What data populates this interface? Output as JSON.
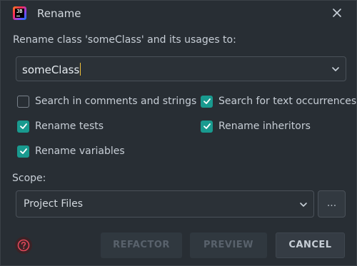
{
  "window": {
    "title": "Rename",
    "app_icon_text": "JB"
  },
  "prompt": "Rename class 'someClass' and its usages to:",
  "new_name": {
    "value": "someClass"
  },
  "options": [
    {
      "label": "Search in comments and strings",
      "checked": false
    },
    {
      "label": "Search for text occurrences",
      "checked": true
    },
    {
      "label": "Rename tests",
      "checked": true
    },
    {
      "label": "Rename inheritors",
      "checked": true
    },
    {
      "label": "Rename variables",
      "checked": true
    }
  ],
  "scope": {
    "label": "Scope:",
    "selected": "Project Files",
    "more_label": "..."
  },
  "buttons": {
    "refactor": "REFACTOR",
    "preview": "PREVIEW",
    "cancel": "CANCEL"
  },
  "colors": {
    "accent_checkbox": "#199a8f",
    "caret": "#f0c03a",
    "help_icon": "#e0485a"
  },
  "icons": {
    "app": "intellij-app-icon",
    "close": "close-icon",
    "dropdown": "chevron-down-icon",
    "help": "question-circle-icon",
    "check": "checkmark-icon"
  }
}
